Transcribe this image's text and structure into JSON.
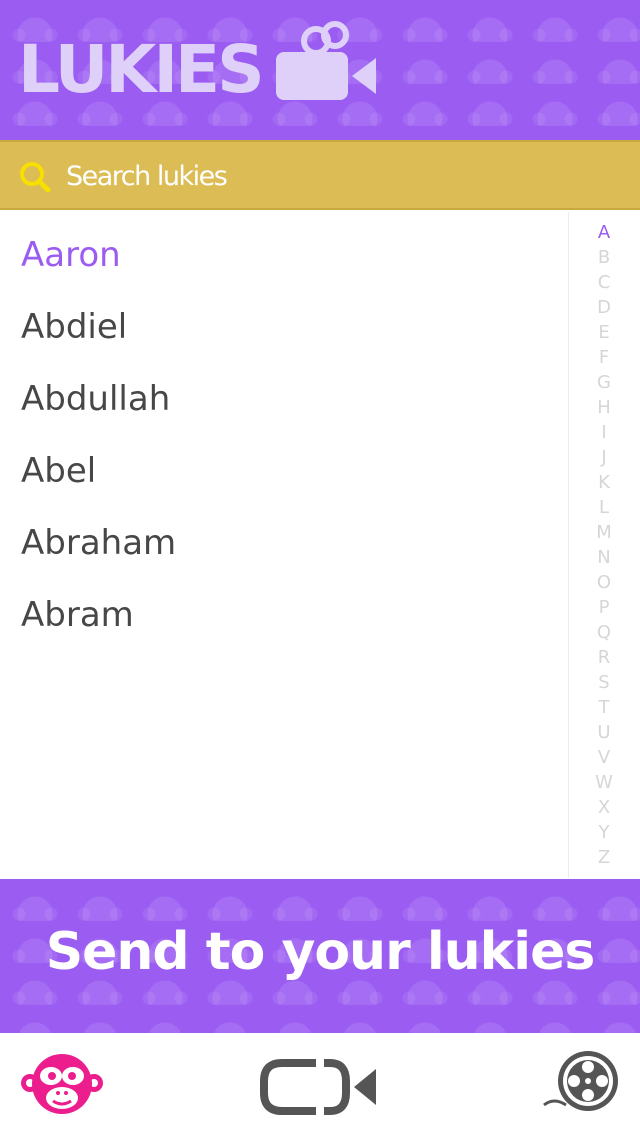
{
  "header": {
    "logo_text": "LUKIES",
    "logo_icon": "video-camera-icon"
  },
  "search": {
    "placeholder": "Search lukies",
    "value": "",
    "icon": "search-icon"
  },
  "contacts": [
    {
      "name": "Aaron",
      "active": true
    },
    {
      "name": "Abdiel",
      "active": false
    },
    {
      "name": "Abdullah",
      "active": false
    },
    {
      "name": "Abel",
      "active": false
    },
    {
      "name": "Abraham",
      "active": false
    },
    {
      "name": "Abram",
      "active": false
    }
  ],
  "alpha_index": {
    "letters": [
      "A",
      "B",
      "C",
      "D",
      "E",
      "F",
      "G",
      "H",
      "I",
      "J",
      "K",
      "L",
      "M",
      "N",
      "O",
      "P",
      "Q",
      "R",
      "S",
      "T",
      "U",
      "V",
      "W",
      "X",
      "Y",
      "Z"
    ],
    "active": "A"
  },
  "send_banner": {
    "label": "Send to your lukies"
  },
  "tab_bar": {
    "items": [
      {
        "icon": "monkey-icon"
      },
      {
        "icon": "video-camera-icon"
      },
      {
        "icon": "film-reel-icon"
      }
    ]
  },
  "colors": {
    "brand_purple": "#9b5cf2",
    "search_yellow": "#dcbd55",
    "search_icon_yellow": "#f7e000",
    "text_dark": "#474747",
    "index_gray": "#d6d6d6",
    "monkey_pink": "#ec1e8e",
    "icon_gray": "#555555"
  }
}
